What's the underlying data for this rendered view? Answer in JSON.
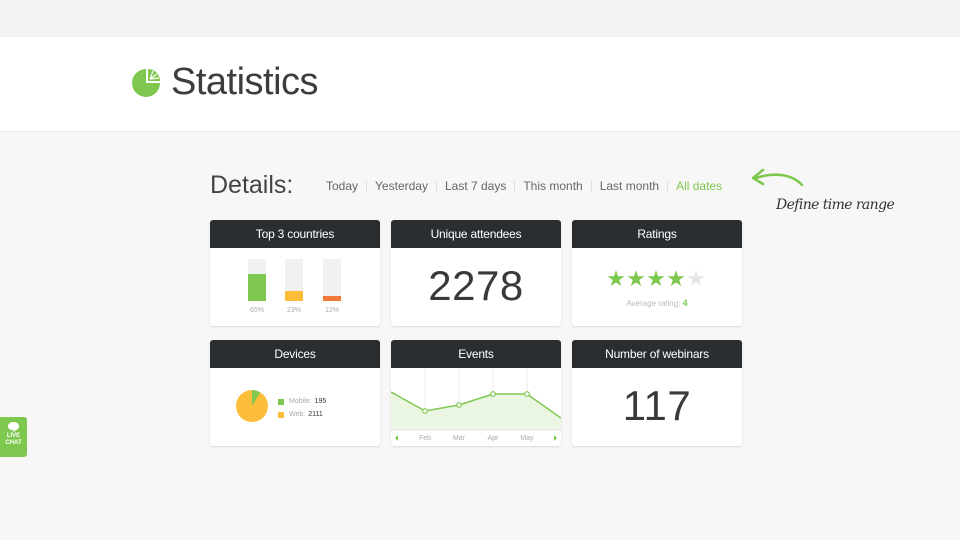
{
  "header": {
    "title": "Statistics",
    "logo_icon": "pie-chart-icon"
  },
  "details": {
    "title": "Details:",
    "ranges": [
      "Today",
      "Yesterday",
      "Last 7 days",
      "This month",
      "Last month",
      "All dates"
    ],
    "active_range": "All dates",
    "hint": "Define time range"
  },
  "cards": {
    "countries": {
      "title": "Top 3 countries",
      "bars": [
        {
          "label": "65%",
          "value": 0.65,
          "color": "#7ec850"
        },
        {
          "label": "23%",
          "value": 0.23,
          "color": "#fbbd3a"
        },
        {
          "label": "12%",
          "value": 0.12,
          "color": "#f07a3a"
        }
      ]
    },
    "attendees": {
      "title": "Unique attendees",
      "value": "2278"
    },
    "ratings": {
      "title": "Ratings",
      "stars_filled": 4,
      "stars_total": 5,
      "avg_label": "Average rating:",
      "avg_value": "4"
    },
    "devices": {
      "title": "Devices",
      "mobile_label": "Mobile:",
      "mobile_value": "195",
      "web_label": "Web:",
      "web_value": "2111",
      "mobile_color": "#7ec850",
      "web_color": "#fbbd3a"
    },
    "events": {
      "title": "Events",
      "months": [
        "Feb",
        "Mar",
        "Apr",
        "May"
      ]
    },
    "webinars": {
      "title": "Number of webinars",
      "value": "117"
    }
  },
  "live_chat": {
    "line1": "LIVE",
    "line2": "CHAT"
  },
  "colors": {
    "accent": "#7ec850",
    "header_dark": "#2b2e31"
  }
}
